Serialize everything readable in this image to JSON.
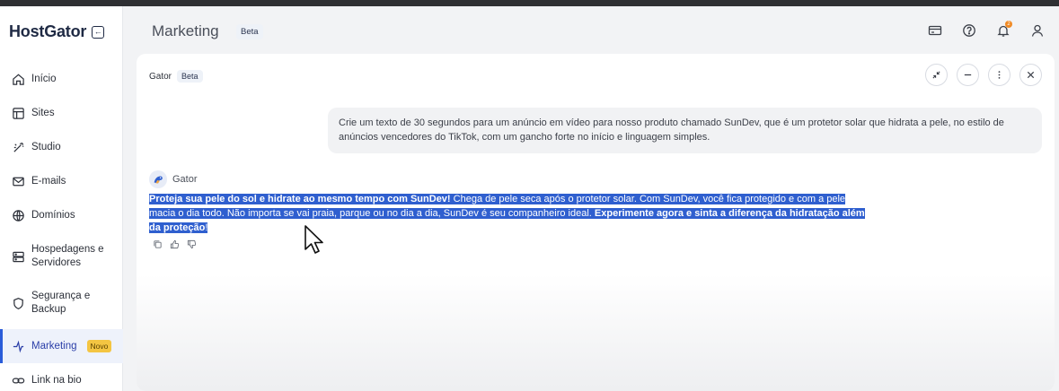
{
  "brand": {
    "name": "HostGator"
  },
  "sidebar": {
    "items": [
      {
        "label": "Início",
        "icon": "home-icon"
      },
      {
        "label": "Sites",
        "icon": "layout-icon"
      },
      {
        "label": "Studio",
        "icon": "wand-icon"
      },
      {
        "label": "E-mails",
        "icon": "mail-icon"
      },
      {
        "label": "Domínios",
        "icon": "globe-icon"
      },
      {
        "label_line1": "Hospedagens e",
        "label_line2": "Servidores",
        "icon": "server-icon"
      },
      {
        "label_line1": "Segurança e",
        "label_line2": "Backup",
        "icon": "shield-icon"
      },
      {
        "label": "Marketing",
        "icon": "sparkle-icon",
        "badge": "Novo",
        "active": true
      },
      {
        "label": "Link na bio",
        "icon": "link-icon"
      }
    ]
  },
  "header": {
    "title": "Marketing",
    "badge": "Beta",
    "notification_count": "2"
  },
  "panel": {
    "title": "Gator",
    "badge": "Beta",
    "user_message": "Crie um texto de 30 segundos para um anúncio em vídeo para nosso produto chamado SunDev, que é um protetor solar que hidrata a pele, no estilo de anúncios vencedores do TikTok, com um gancho forte no início e linguagem simples.",
    "bot_name": "Gator",
    "bot_message": {
      "bold_start": "Proteja sua pele do sol e hidrate ao mesmo tempo com SunDev!",
      "middle": " Chega de pele seca após o protetor solar. Com SunDev, você fica protegido e com a pele macia o dia todo. Não importa se vai praia, parque ou no dia a dia, SunDev é seu companheiro ideal. ",
      "bold_end": "Experimente agora e sinta a diferença da hidratação além da proteção",
      "tail": "!"
    }
  },
  "colors": {
    "selection": "#2f5fcf",
    "active_nav": "#2a5cd9",
    "badge_novo": "#f4c542",
    "notification": "#f08a24"
  }
}
